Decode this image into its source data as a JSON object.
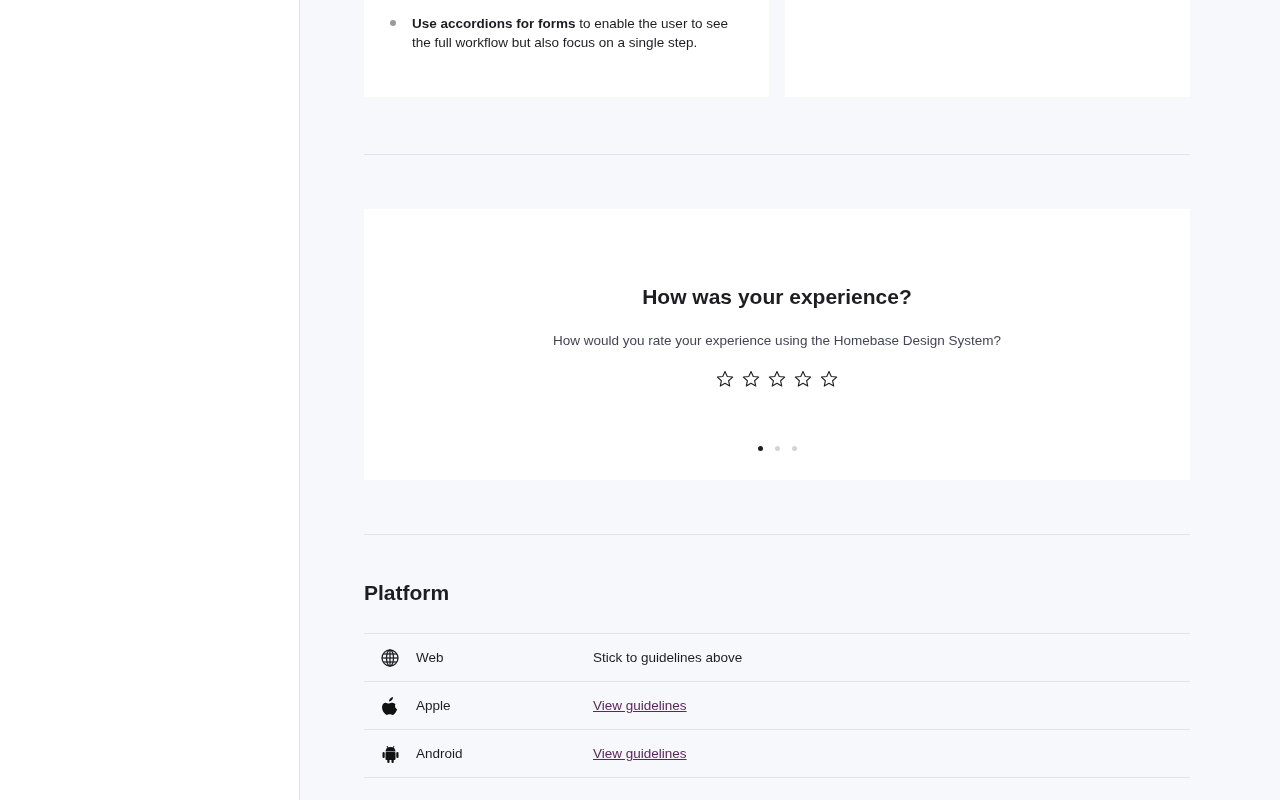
{
  "top_cards": [
    {
      "bullets": [
        "**Use accordions for forms** to enable the user to see the full workflow but also focus on a single step."
      ]
    }
  ],
  "survey": {
    "title": "How was your experience?",
    "question": "How would you rate your experience using the Homebase Design System?",
    "stars": 0,
    "pages": [
      {
        "selected": true
      },
      {
        "selected": false
      },
      {
        "selected": false
      }
    ]
  },
  "platform": {
    "heading": "Platform",
    "rows": [
      {
        "name": "Web",
        "kind": "text",
        "value": "Stick to guidelines above"
      },
      {
        "name": "Apple",
        "kind": "link",
        "value": "View guidelines"
      },
      {
        "name": "Android",
        "kind": "link",
        "value": "View guidelines"
      }
    ]
  }
}
